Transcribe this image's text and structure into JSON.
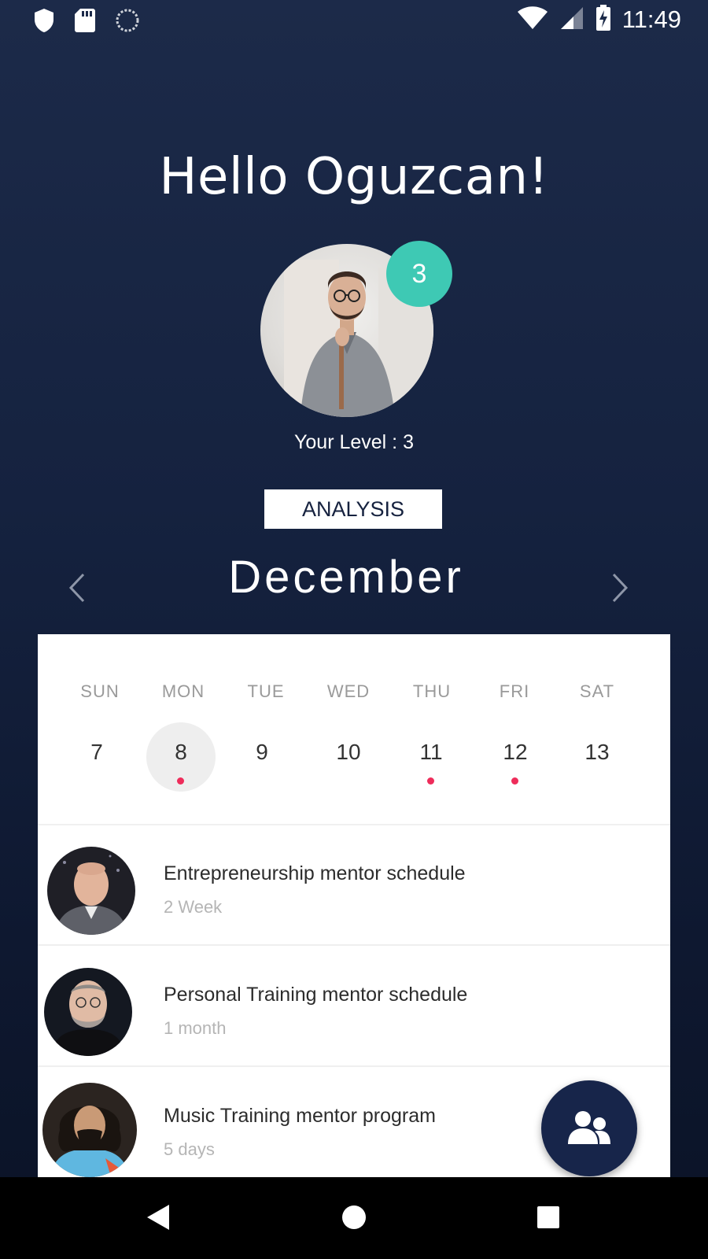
{
  "status_bar": {
    "time": "11:49",
    "left_icons": [
      "shield-icon",
      "sd-card-icon",
      "sync-icon"
    ],
    "right_icons": [
      "wifi-icon",
      "signal-icon",
      "battery-charging-icon"
    ]
  },
  "header": {
    "greeting": "Hello Oguzcan!",
    "level_badge": "3",
    "level_text": "Your Level : 3",
    "analysis_label": "ANALYSIS"
  },
  "calendar": {
    "month": "December",
    "weekdays": [
      "SUN",
      "MON",
      "TUE",
      "WED",
      "THU",
      "FRI",
      "SAT"
    ],
    "dates": [
      {
        "day": "7",
        "selected": false,
        "has_event": false
      },
      {
        "day": "8",
        "selected": true,
        "has_event": true
      },
      {
        "day": "9",
        "selected": false,
        "has_event": false
      },
      {
        "day": "10",
        "selected": false,
        "has_event": false
      },
      {
        "day": "11",
        "selected": false,
        "has_event": true
      },
      {
        "day": "12",
        "selected": false,
        "has_event": true
      },
      {
        "day": "13",
        "selected": false,
        "has_event": false
      }
    ],
    "event_dot_color": "#ee2c5a"
  },
  "mentors": [
    {
      "title": "Entrepreneurship mentor schedule",
      "subtitle": "2 Week"
    },
    {
      "title": "Personal Training mentor schedule",
      "subtitle": "1 month"
    },
    {
      "title": "Music Training mentor program",
      "subtitle": "5 days"
    }
  ],
  "fab": {
    "icon": "users-icon"
  },
  "nav_bar": {
    "icons": [
      "back-icon",
      "home-icon",
      "recents-icon"
    ]
  },
  "colors": {
    "accent_teal": "#3ec9b4",
    "navy": "#17254a"
  }
}
